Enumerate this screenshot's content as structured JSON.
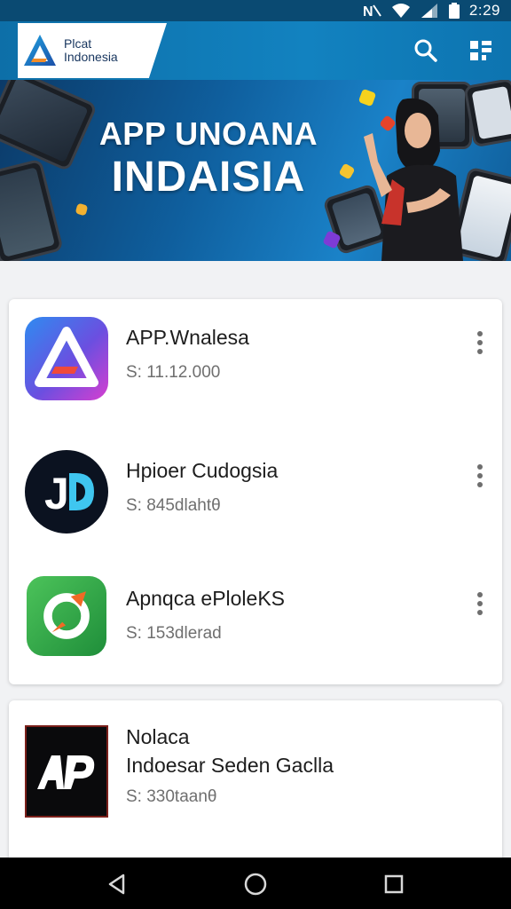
{
  "status_bar": {
    "time": "2:29",
    "icons": [
      "nfc-icon",
      "wifi-icon",
      "signal-icon",
      "battery-icon"
    ]
  },
  "app_bar": {
    "logo_line1": "Plcat",
    "logo_line2": "Indonesia",
    "icons": [
      "search-icon",
      "grid-icon"
    ]
  },
  "hero": {
    "title_line1": "APP UNOANA",
    "title_line2": "INDAISIA"
  },
  "apps": [
    {
      "name": "APP.Wnalesa",
      "price": "S: 11.12.000",
      "icon": "app-unoana-icon"
    },
    {
      "name": "Hpioer Cudogsia",
      "price": "S: 845dlahtθ",
      "icon": "jd-app-icon"
    },
    {
      "name": "Apnqca ePloleKS",
      "price": "S: 153dlerad",
      "icon": "rocket-app-icon"
    }
  ],
  "featured_app": {
    "name": "Nolaca",
    "subtitle": "Indoesar Seden Gaclla",
    "price": "S: 330taanθ",
    "icon": "ap-app-icon"
  },
  "nav_bar": {
    "icons": [
      "back-icon",
      "home-icon",
      "recents-icon"
    ]
  },
  "colors": {
    "app_bar": "#1282c0",
    "status_bar": "#0a4a72",
    "hero_dark": "#0b3a68",
    "card": "#ffffff",
    "background": "#f1f2f4"
  }
}
